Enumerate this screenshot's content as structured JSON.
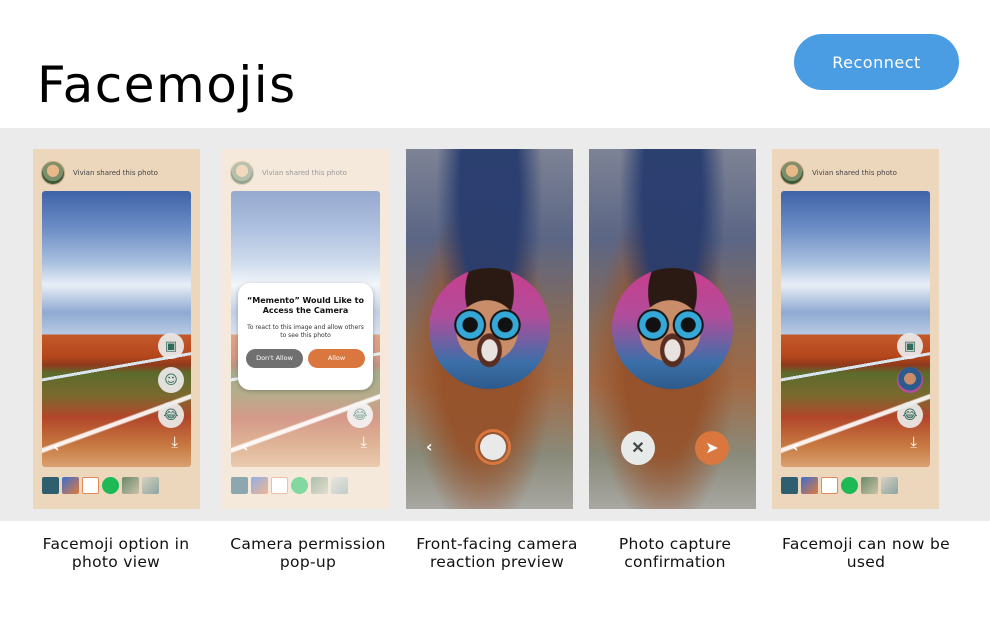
{
  "page": {
    "title": "Facemojis",
    "reconnect_label": "Reconnect"
  },
  "app": {
    "header_text": "Vivian shared this photo"
  },
  "dialog": {
    "title": "“Memento” Would Like to Access the Camera",
    "body": "To react to this image and allow others to see this photo",
    "deny_label": "Don't Allow",
    "allow_label": "Allow"
  },
  "captions": [
    "Facemoji option in photo view",
    "Camera permission pop-up",
    "Front-facing camera reaction preview",
    "Photo capture confirmation",
    "Facemoji can now be used"
  ],
  "icons": {
    "back": "chevron-left-icon",
    "download": "download-icon",
    "crop": "crop-icon",
    "add_reaction": "add-reaction-icon",
    "laugh": "laughing-emoji-icon",
    "cancel": "close-icon",
    "send": "send-icon"
  },
  "colors": {
    "accent_blue": "#4a9de3",
    "accent_orange": "#d9773f",
    "band_gray": "#ebebeb",
    "app_beige": "#ecd7bd"
  }
}
